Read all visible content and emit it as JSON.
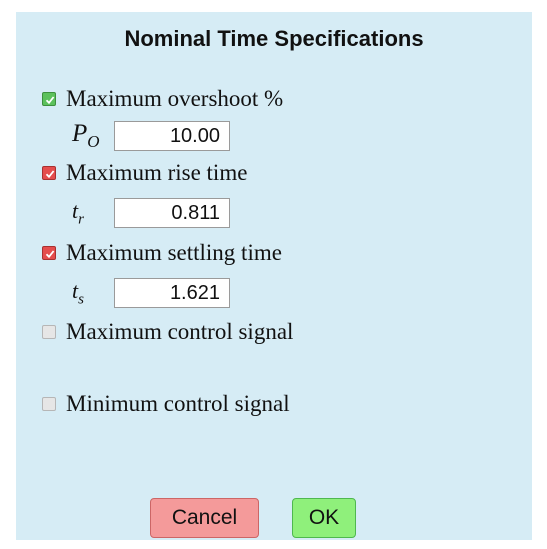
{
  "dialog": {
    "title": "Nominal Time Specifications"
  },
  "specs": [
    {
      "label": "Maximum overshoot %",
      "checked": true,
      "check_color": "#5cc15c",
      "symbol": "P",
      "symbol_sub": "O",
      "value": "10.00"
    },
    {
      "label": "Maximum rise time",
      "checked": true,
      "check_color": "#e44d4d",
      "symbol": "t",
      "symbol_sub": "r",
      "value": "0.811"
    },
    {
      "label": "Maximum settling time",
      "checked": true,
      "check_color": "#e44d4d",
      "symbol": "t",
      "symbol_sub": "s",
      "value": "1.621"
    },
    {
      "label": "Maximum control signal",
      "checked": false
    },
    {
      "label": "Minimum control signal",
      "checked": false
    }
  ],
  "buttons": {
    "cancel": "Cancel",
    "ok": "OK"
  },
  "colors": {
    "dialog_bg": "#d6ecf5",
    "cancel_bg": "#f49a9a",
    "ok_bg": "#8ff07b"
  }
}
